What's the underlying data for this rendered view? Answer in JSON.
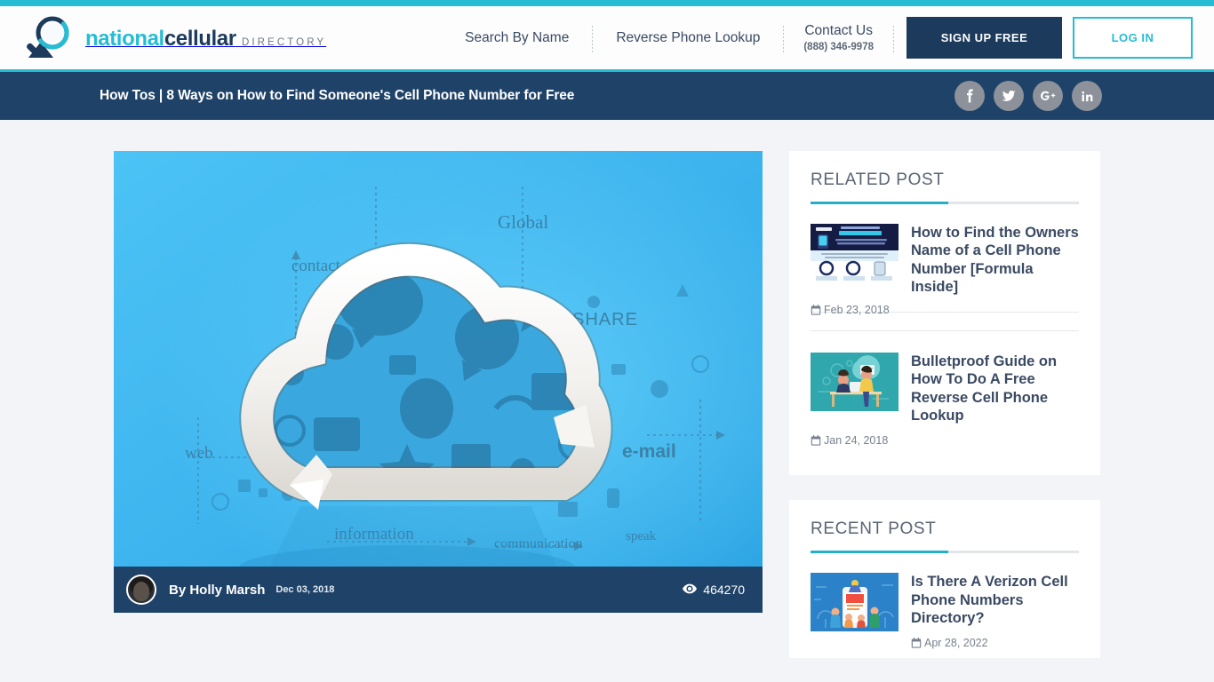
{
  "brand": {
    "logo_line1_part1": "national",
    "logo_line1_part2": "cellular",
    "logo_line2": "DIRECTORY",
    "accent_color": "#26bdd4",
    "dark_color": "#1b3a5c"
  },
  "header": {
    "nav": [
      {
        "label": "Search By Name",
        "name": "nav-search-by-name"
      },
      {
        "label": "Reverse Phone Lookup",
        "name": "nav-reverse-phone-lookup"
      }
    ],
    "contact": {
      "title": "Contact Us",
      "phone": "(888) 346-9978"
    },
    "signup_label": "SIGN UP FREE",
    "login_label": "LOG IN"
  },
  "title_bar": {
    "breadcrumb_category": "How Tos",
    "separator": "|",
    "post_title": "8 Ways on How to Find Someone's Cell Phone Number for Free",
    "full_title": "How Tos | 8 Ways on How to Find Someone's Cell Phone Number for Free",
    "social": [
      {
        "name": "facebook-icon",
        "label": "f"
      },
      {
        "name": "twitter-icon",
        "label": "t"
      },
      {
        "name": "google-plus-icon",
        "label": "G+"
      },
      {
        "name": "linkedin-icon",
        "label": "in"
      }
    ]
  },
  "article": {
    "featured_image_alt": "Cloud with refresh arrows surrounded by communication icons on blue background",
    "featured_image_labels": [
      "contact",
      "Global",
      "SHARE",
      "web",
      "e-mail",
      "speak",
      "information",
      "communication"
    ],
    "author_prefix": "By Holly Marsh",
    "date": "Dec 03, 2018",
    "view_count": "464270"
  },
  "sidebar": {
    "related": {
      "heading": "RELATED POST",
      "posts": [
        {
          "title": "How to Find the Owners Name of a Cell Phone Number [Formula Inside]",
          "date": "Feb 23, 2018",
          "thumb": "infographic-owners-name"
        },
        {
          "title": "Bulletproof Guide on How To Do A Free Reverse Cell Phone Lookup",
          "date": "Jan 24, 2018",
          "thumb": "illustration-desk-consult"
        }
      ]
    },
    "recent": {
      "heading": "RECENT POST",
      "posts": [
        {
          "title": "Is There A Verizon Cell Phone Numbers Directory?",
          "date": "Apr 28, 2022",
          "thumb": "illustration-phone-crowd"
        }
      ]
    }
  }
}
